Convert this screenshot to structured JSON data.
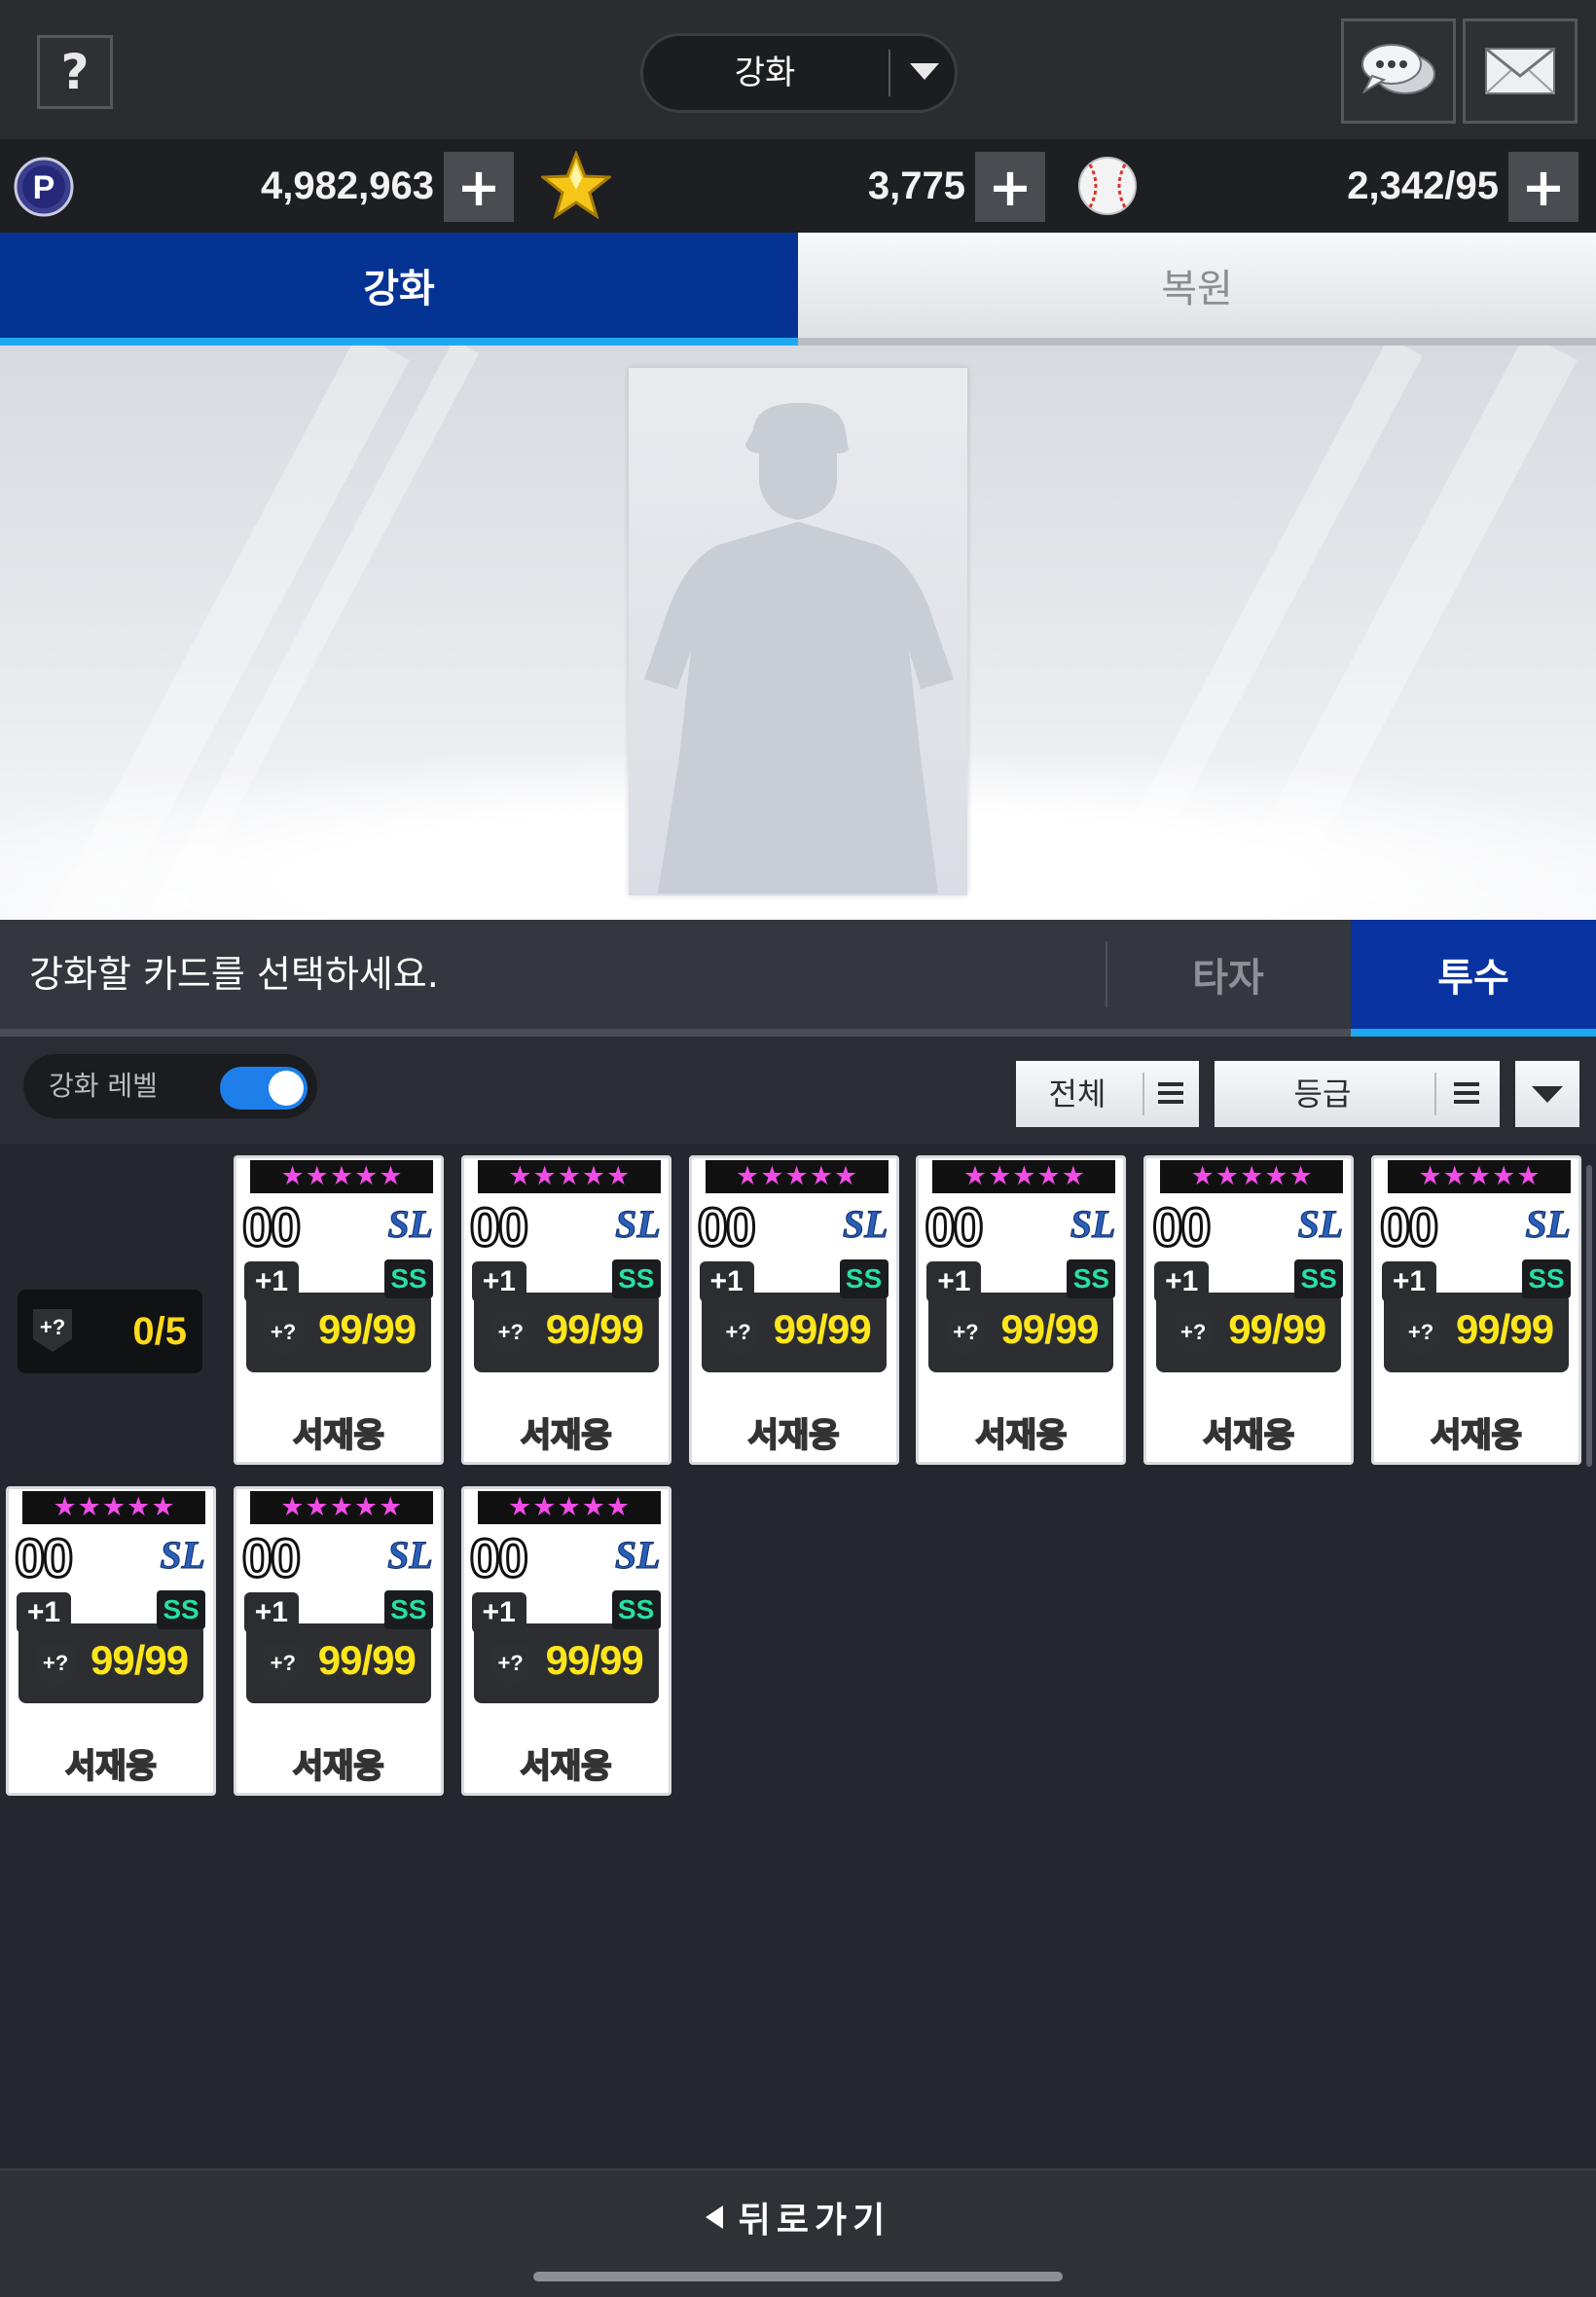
{
  "header": {
    "help_label": "?",
    "mode_label": "강화"
  },
  "currency": {
    "points": "4,982,963",
    "stars": "3,775",
    "balls": "2,342/95",
    "plus_label": "+"
  },
  "main_tabs": {
    "enhance": "강화",
    "restore": "복원"
  },
  "selection": {
    "message": "강화할 카드를 선택하세요.",
    "hitter_tab": "타자",
    "pitcher_tab": "투수"
  },
  "filters": {
    "enhance_level_label": "강화 레벨",
    "enhance_level_on": true,
    "all_label": "전체",
    "grade_label": "등급"
  },
  "level_chip": {
    "badge": "+?",
    "value": "0/5"
  },
  "cards": [
    {
      "stars": 5,
      "number": "00",
      "team": "SL",
      "plus": "+1",
      "grade": "SS",
      "badge": "+?",
      "overall": "99/99",
      "name": "서재응"
    },
    {
      "stars": 5,
      "number": "00",
      "team": "SL",
      "plus": "+1",
      "grade": "SS",
      "badge": "+?",
      "overall": "99/99",
      "name": "서재응"
    },
    {
      "stars": 5,
      "number": "00",
      "team": "SL",
      "plus": "+1",
      "grade": "SS",
      "badge": "+?",
      "overall": "99/99",
      "name": "서재응"
    },
    {
      "stars": 5,
      "number": "00",
      "team": "SL",
      "plus": "+1",
      "grade": "SS",
      "badge": "+?",
      "overall": "99/99",
      "name": "서재응"
    },
    {
      "stars": 5,
      "number": "00",
      "team": "SL",
      "plus": "+1",
      "grade": "SS",
      "badge": "+?",
      "overall": "99/99",
      "name": "서재응"
    },
    {
      "stars": 5,
      "number": "00",
      "team": "SL",
      "plus": "+1",
      "grade": "SS",
      "badge": "+?",
      "overall": "99/99",
      "name": "서재응"
    },
    {
      "stars": 5,
      "number": "00",
      "team": "SL",
      "plus": "+1",
      "grade": "SS",
      "badge": "+?",
      "overall": "99/99",
      "name": "서재응"
    },
    {
      "stars": 5,
      "number": "00",
      "team": "SL",
      "plus": "+1",
      "grade": "SS",
      "badge": "+?",
      "overall": "99/99",
      "name": "서재응"
    },
    {
      "stars": 5,
      "number": "00",
      "team": "SL",
      "plus": "+1",
      "grade": "SS",
      "badge": "+?",
      "overall": "99/99",
      "name": "서재응"
    }
  ],
  "footer": {
    "back_label": "뒤로가기"
  },
  "colors": {
    "active_tab": "#053394",
    "accent_underline": "#1ea8f0",
    "overall_text": "#ffe61a",
    "grade_text": "#27e0a3",
    "star_color": "#f04de6"
  },
  "icons": {
    "points": "p-coin-icon",
    "stars": "gold-star-icon",
    "balls": "baseball-icon",
    "chat": "chat-bubble-icon",
    "mail": "mail-envelope-icon"
  }
}
